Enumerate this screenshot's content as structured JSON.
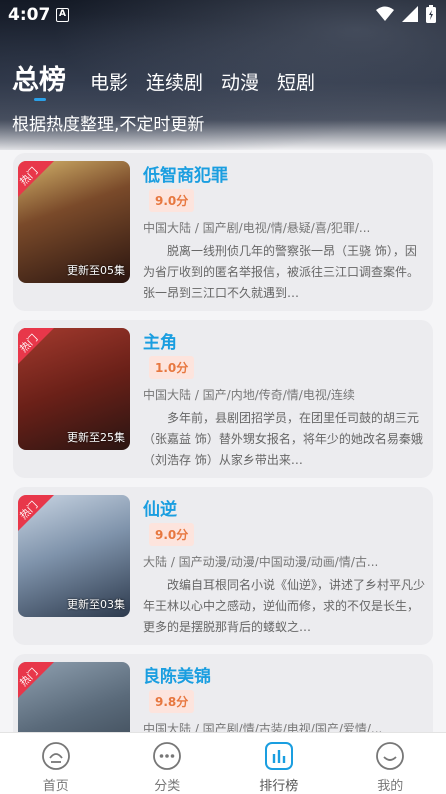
{
  "status": {
    "time": "4:07",
    "notif_icon": "A"
  },
  "tabs": [
    {
      "label": "总榜",
      "active": true
    },
    {
      "label": "电影"
    },
    {
      "label": "连续剧"
    },
    {
      "label": "动漫"
    },
    {
      "label": "短剧"
    }
  ],
  "subtitle": "根据热度整理,不定时更新",
  "items": [
    {
      "title": "低智商犯罪",
      "score": "9.0分",
      "tags": "中国大陆 / 国产剧/电视/情/悬疑/喜/犯罪/...",
      "desc": "脱离一线刑侦几年的警察张一昂（王骁 饰），因为省厅收到的匿名举报信，被派往三江口调查案件。张一昂到三江口不久就遇到…",
      "update": "更新至05集",
      "badge": "热门",
      "poster_colors": [
        "#c9a35a",
        "#3a1f18"
      ]
    },
    {
      "title": "主角",
      "score": "1.0分",
      "tags": "中国大陆 / 国产/内地/传奇/情/电视/连续",
      "desc": "多年前，县剧团招学员，在团里任司鼓的胡三元（张嘉益 饰）替外甥女报名，将年少的她改名易秦娥（刘浩存 饰）从家乡带出来…",
      "update": "更新至25集",
      "badge": "热门",
      "poster_colors": [
        "#8a2a22",
        "#2a1512"
      ]
    },
    {
      "title": "仙逆",
      "score": "9.0分",
      "tags": "大陆 / 国产动漫/动漫/中国动漫/动画/情/古...",
      "desc": "改编自耳根同名小说《仙逆》，讲述了乡村平凡少年王林以心中之感动，逆仙而修，求的不仅是长生，更多的是摆脱那背后的蝼蚁之…",
      "update": "更新至03集",
      "badge": "热门",
      "poster_colors": [
        "#9fb2c8",
        "#2d3a4d"
      ]
    },
    {
      "title": "良陈美锦",
      "score": "9.8分",
      "tags": "中国大陆 / 国产剧/情/古装/电视/国产/爱情/...",
      "desc": "",
      "update": "",
      "badge": "热门",
      "poster_colors": [
        "#6d7f90",
        "#303b47"
      ]
    }
  ],
  "nav": [
    {
      "label": "首页",
      "icon": "home-icon"
    },
    {
      "label": "分类",
      "icon": "category-icon"
    },
    {
      "label": "排行榜",
      "icon": "ranking-icon",
      "active": true
    },
    {
      "label": "我的",
      "icon": "profile-icon"
    }
  ],
  "colors": {
    "accent": "#1a9ee0",
    "score_bg": "#fde4dd",
    "score_fg": "#e7773f",
    "hot": "#e8374a"
  }
}
